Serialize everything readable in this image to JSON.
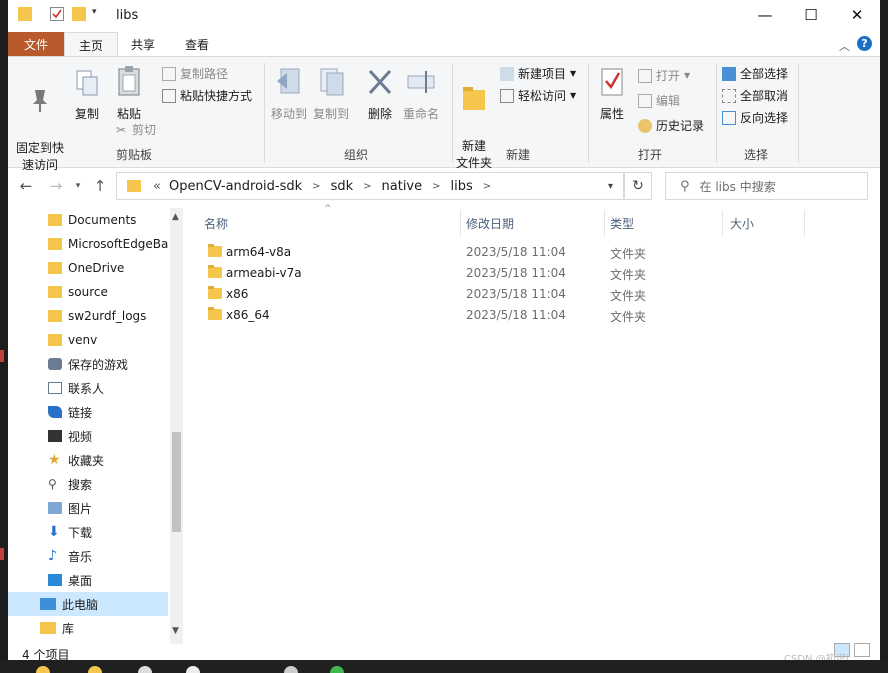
{
  "window": {
    "title": "libs"
  },
  "titlebar": {
    "minimize": "—",
    "maximize": "☐",
    "close": "✕"
  },
  "tabs": {
    "file": "文件",
    "home": "主页",
    "share": "共享",
    "view": "查看"
  },
  "ribbon": {
    "clipboard": {
      "label": "剪贴板",
      "pin": "固定到快\n速访问",
      "copy": "复制",
      "paste": "粘贴",
      "copy_path": "复制路径",
      "paste_shortcut": "粘贴快捷方式",
      "cut": "剪切"
    },
    "organize": {
      "label": "组织",
      "move_to": "移动到",
      "copy_to": "复制到",
      "delete": "删除",
      "rename": "重命名"
    },
    "new": {
      "label": "新建",
      "new_folder": "新建\n文件夹",
      "new_item": "新建项目",
      "easy_access": "轻松访问"
    },
    "open": {
      "label": "打开",
      "properties": "属性",
      "open": "打开",
      "edit": "编辑",
      "history": "历史记录"
    },
    "select": {
      "label": "选择",
      "select_all": "全部选择",
      "select_none": "全部取消",
      "invert": "反向选择"
    }
  },
  "address": {
    "prefix": "«",
    "crumbs": [
      "OpenCV-android-sdk",
      "sdk",
      "native",
      "libs"
    ]
  },
  "search": {
    "placeholder": "在 libs 中搜索"
  },
  "nav": {
    "items": [
      "Documents",
      "MicrosoftEdgeBa",
      "OneDrive",
      "source",
      "sw2urdf_logs",
      "venv",
      "保存的游戏",
      "联系人",
      "链接",
      "视频",
      "收藏夹",
      "搜索",
      "图片",
      "下载",
      "音乐",
      "桌面",
      "此电脑",
      "库"
    ]
  },
  "columns": {
    "name": "名称",
    "date": "修改日期",
    "type": "类型",
    "size": "大小"
  },
  "files": [
    {
      "name": "arm64-v8a",
      "date": "2023/5/18 11:04",
      "type": "文件夹"
    },
    {
      "name": "armeabi-v7a",
      "date": "2023/5/18 11:04",
      "type": "文件夹"
    },
    {
      "name": "x86",
      "date": "2023/5/18 11:04",
      "type": "文件夹"
    },
    {
      "name": "x86_64",
      "date": "2023/5/18 11:04",
      "type": "文件夹"
    }
  ],
  "status": {
    "count": "4 个项目"
  },
  "watermark": "CSDN @初识i",
  "colors": {
    "file_tab": "#b85a2b",
    "accent": "#1a6fc6",
    "selection": "#cce8ff",
    "folder": "#f4c64c"
  }
}
